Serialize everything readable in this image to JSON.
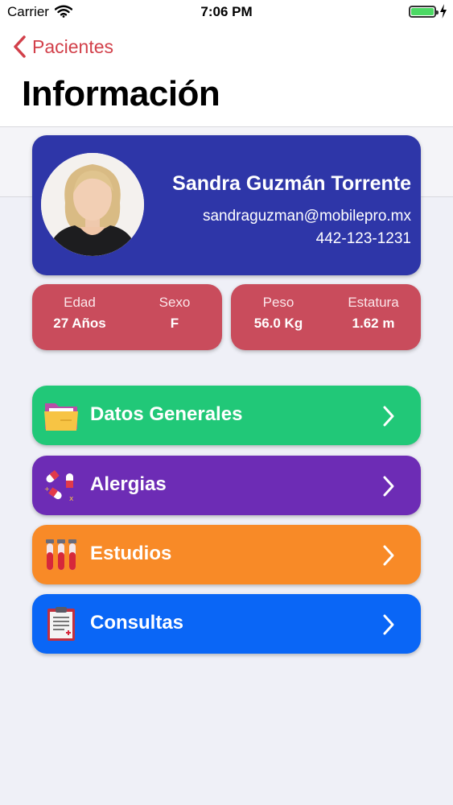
{
  "status_bar": {
    "carrier": "Carrier",
    "time": "7:06 PM"
  },
  "nav": {
    "back_label": "Pacientes",
    "title": "Información"
  },
  "profile": {
    "name": "Sandra Guzmán Torrente",
    "email": "sandraguzman@mobilepro.mx",
    "phone": "442-123-1231"
  },
  "stats": [
    {
      "label": "Edad",
      "value": "27 Años"
    },
    {
      "label": "Sexo",
      "value": "F"
    },
    {
      "label": "Peso",
      "value": "56.0 Kg"
    },
    {
      "label": "Estatura",
      "value": "1.62 m"
    }
  ],
  "menu": [
    {
      "label": "Datos Generales",
      "icon": "folder-icon",
      "color": "#21c878"
    },
    {
      "label": "Alergias",
      "icon": "pills-icon",
      "color": "#6d2cb5"
    },
    {
      "label": "Estudios",
      "icon": "test-tubes-icon",
      "color": "#f88a27"
    },
    {
      "label": "Consultas",
      "icon": "clipboard-icon",
      "color": "#0a66f6"
    }
  ],
  "colors": {
    "accent": "#d2404a",
    "profile_card": "#2e36a8",
    "stats_card": "#c94c5c",
    "background": "#eff0f7"
  }
}
